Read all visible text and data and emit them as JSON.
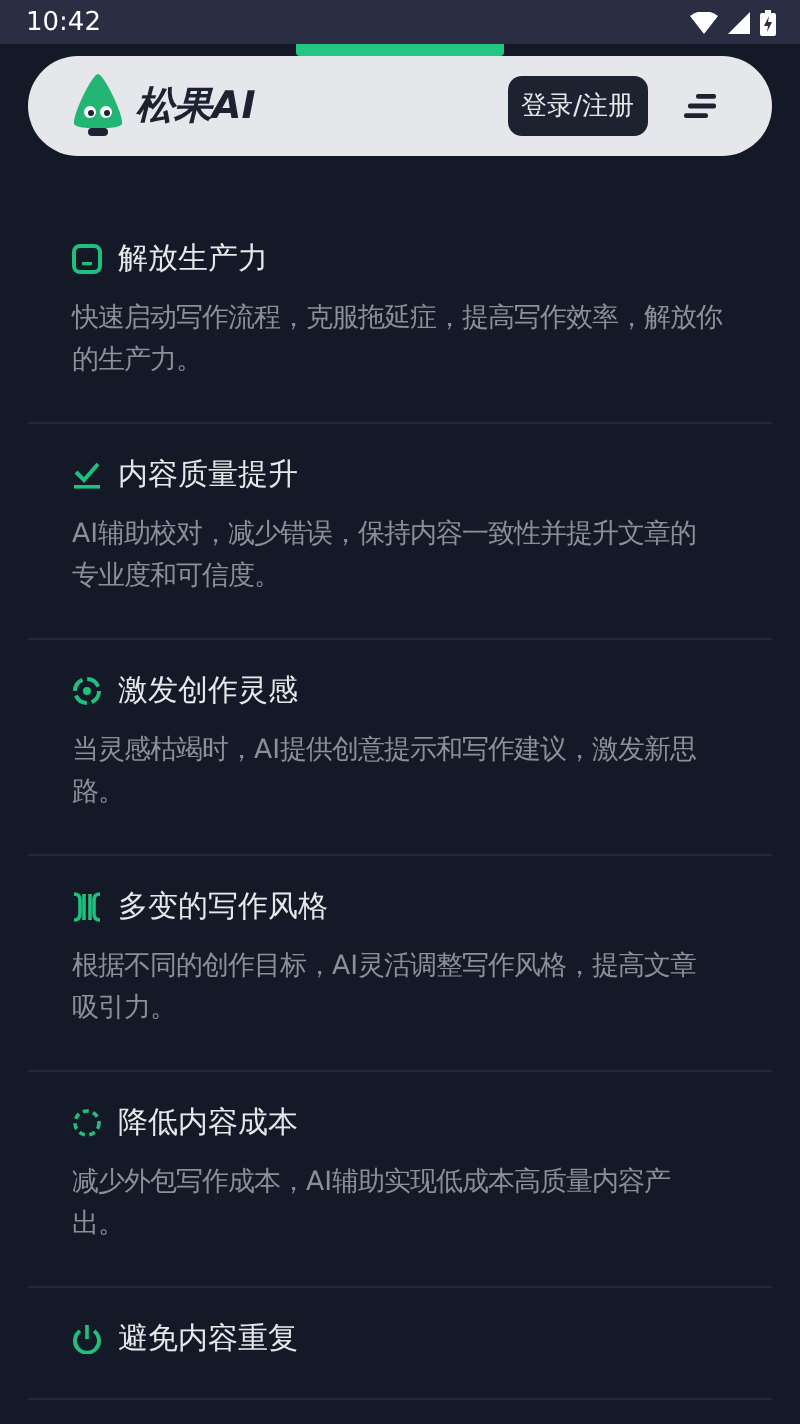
{
  "status_bar": {
    "time": "10:42"
  },
  "header": {
    "brand": "松果AI",
    "login_button": "登录/注册"
  },
  "features": [
    {
      "kind": "screen",
      "title": "解放生产力",
      "description": "快速启动写作流程，克服拖延症，提高写作效率，解放你的生产力。"
    },
    {
      "kind": "check",
      "title": "内容质量提升",
      "description": "AI辅助校对，减少错误，保持内容一致性并提升文章的专业度和可信度。"
    },
    {
      "kind": "target",
      "title": "激发创作灵感",
      "description": "当灵感枯竭时，AI提供创意提示和写作建议，激发新思路。"
    },
    {
      "kind": "split",
      "title": "多变的写作风格",
      "description": "根据不同的创作目标，AI灵活调整写作风格，提高文章吸引力。"
    },
    {
      "kind": "dashed-circle",
      "title": "降低内容成本",
      "description": "减少外包写作成本，AI辅助实现低成本高质量内容产出。"
    },
    {
      "kind": "power",
      "title": "避免内容重复"
    }
  ]
}
